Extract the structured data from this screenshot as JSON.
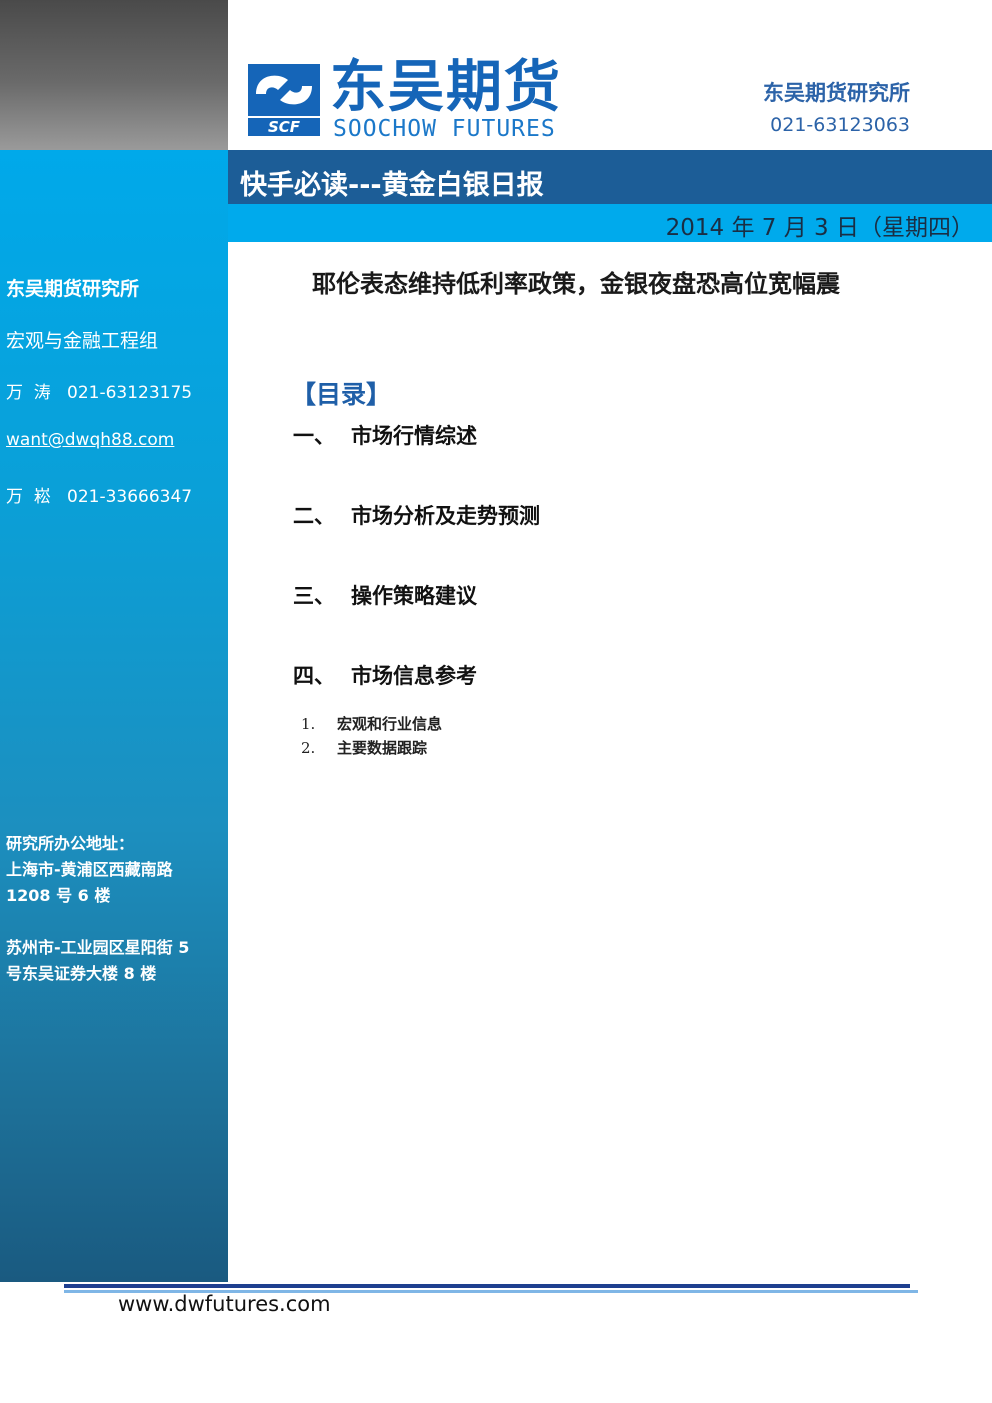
{
  "sidebar": {
    "org": "东吴期货研究所",
    "group": "宏观与金融工程组",
    "contact1": "万  涛   021-63123175",
    "email": "want@dwqh88.com",
    "contact2": "万  崧   021-33666347",
    "address_title": "研究所办公地址：",
    "address_sh_line1": "上海市-黄浦区西藏南路",
    "address_sh_line2": "1208 号 6 楼",
    "address_sz_line1": "苏州市-工业园区星阳街 5",
    "address_sz_line2": "号东吴证券大楼 8 楼"
  },
  "header": {
    "logo_cn": "东吴期货",
    "logo_en": "SOOCHOW FUTURES",
    "logo_mark_text": "SCF",
    "org": "东吴期货研究所",
    "phone": "021-63123063"
  },
  "report": {
    "title": "快手必读---黄金白银日报",
    "date": "2014 年 7 月 3 日（星期四）",
    "headline": "耶伦表态维持低利率政策，金银夜盘恐高位宽幅震"
  },
  "toc": {
    "heading": "【目录】",
    "items": [
      {
        "num": "一、",
        "label": "市场行情综述"
      },
      {
        "num": "二、",
        "label": "市场分析及走势预测"
      },
      {
        "num": "三、",
        "label": "操作策略建议"
      },
      {
        "num": "四、",
        "label": "市场信息参考"
      }
    ],
    "subitems": [
      {
        "num": "1.",
        "label": "宏观和行业信息"
      },
      {
        "num": "2.",
        "label": "主要数据跟踪"
      }
    ]
  },
  "footer": {
    "url": "www.dwfutures.com"
  },
  "colors": {
    "brand_blue": "#1565b8",
    "title_bar": "#1c5d97",
    "date_bar": "#00aaec",
    "sidebar_top": "#00a9ea",
    "sidebar_bottom": "#1a5a80"
  }
}
